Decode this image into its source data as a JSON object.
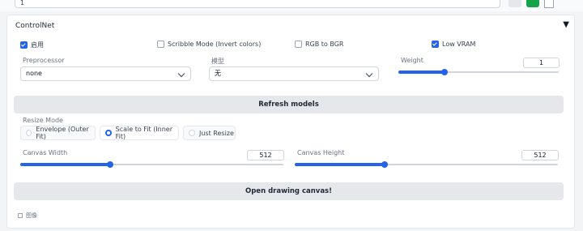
{
  "top": {
    "prompt_value": "1"
  },
  "panel": {
    "title": "ControlNet",
    "collapse_glyph": "▼",
    "checkboxes": [
      {
        "label": "启用",
        "checked": true
      },
      {
        "label": "Scribble Mode (Invert colors)",
        "checked": false
      },
      {
        "label": "RGB to BGR",
        "checked": false
      },
      {
        "label": "Low VRAM",
        "checked": true
      }
    ],
    "preprocessor": {
      "label": "Preprocessor",
      "value": "none"
    },
    "model": {
      "label": "模型",
      "value": "无"
    },
    "weight": {
      "label": "Weight",
      "value": "1",
      "fraction": 0.29
    },
    "refresh_label": "Refresh models",
    "resize": {
      "label": "Resize Mode",
      "options": [
        "Envelope (Outer Fit)",
        "Scale to Fit (Inner Fit)",
        "Just Resize"
      ],
      "selected": 1
    },
    "canvas_width": {
      "label": "Canvas Width",
      "value": "512",
      "fraction": 0.34
    },
    "canvas_height": {
      "label": "Canvas Height",
      "value": "512",
      "fraction": 0.34
    },
    "open_canvas_label": "Open drawing canvas!",
    "footer_label": "图像"
  },
  "colors": {
    "accent": "#2563eb",
    "button_bg": "#e5e7eb",
    "green": "#16a34a"
  },
  "icons": [
    "settings-icon",
    "paste-icon",
    "collapse-arrow-icon",
    "chevron-down-icon"
  ]
}
